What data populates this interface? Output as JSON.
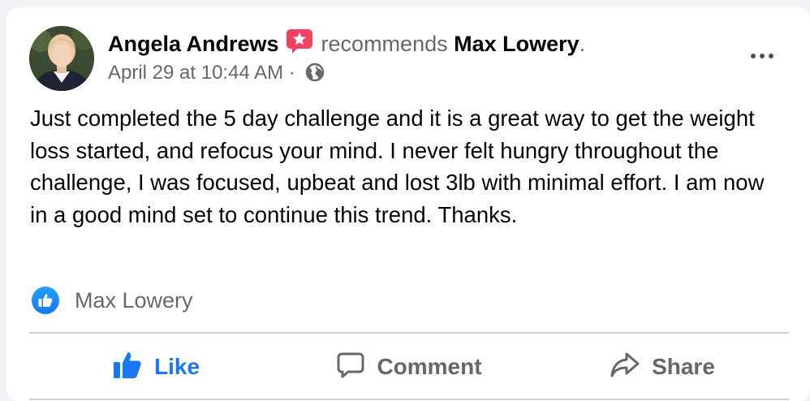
{
  "post": {
    "author": "Angela Andrews",
    "action_text": "recommends",
    "target": "Max Lowery",
    "target_suffix": ".",
    "timestamp": "April 29 at 10:44 AM",
    "separator": "·",
    "privacy_icon": "globe-icon",
    "body": "Just completed the 5 day challenge and it is a great way to get the weight loss started, and refocus your mind. I never felt hungry throughout the challenge, I was focused, upbeat and lost 3lb with minimal effort. I am now in a good mind set to continue this trend. Thanks.",
    "liked_page": "Max Lowery"
  },
  "actions": {
    "like_label": "Like",
    "comment_label": "Comment",
    "share_label": "Share"
  },
  "colors": {
    "facebook_blue": "#1877f2",
    "recommend_badge": "#f3425f",
    "secondary_text": "#65676b",
    "primary_text": "#050505"
  }
}
